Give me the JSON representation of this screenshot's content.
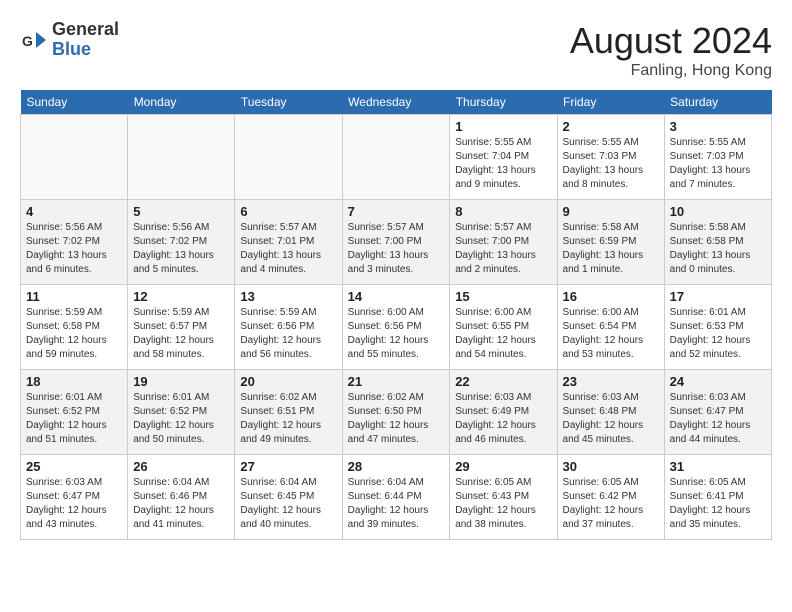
{
  "header": {
    "logo_general": "General",
    "logo_blue": "Blue",
    "month_title": "August 2024",
    "location": "Fanling, Hong Kong"
  },
  "days_of_week": [
    "Sunday",
    "Monday",
    "Tuesday",
    "Wednesday",
    "Thursday",
    "Friday",
    "Saturday"
  ],
  "weeks": [
    [
      {
        "day": "",
        "info": ""
      },
      {
        "day": "",
        "info": ""
      },
      {
        "day": "",
        "info": ""
      },
      {
        "day": "",
        "info": ""
      },
      {
        "day": "1",
        "info": "Sunrise: 5:55 AM\nSunset: 7:04 PM\nDaylight: 13 hours\nand 9 minutes."
      },
      {
        "day": "2",
        "info": "Sunrise: 5:55 AM\nSunset: 7:03 PM\nDaylight: 13 hours\nand 8 minutes."
      },
      {
        "day": "3",
        "info": "Sunrise: 5:55 AM\nSunset: 7:03 PM\nDaylight: 13 hours\nand 7 minutes."
      }
    ],
    [
      {
        "day": "4",
        "info": "Sunrise: 5:56 AM\nSunset: 7:02 PM\nDaylight: 13 hours\nand 6 minutes."
      },
      {
        "day": "5",
        "info": "Sunrise: 5:56 AM\nSunset: 7:02 PM\nDaylight: 13 hours\nand 5 minutes."
      },
      {
        "day": "6",
        "info": "Sunrise: 5:57 AM\nSunset: 7:01 PM\nDaylight: 13 hours\nand 4 minutes."
      },
      {
        "day": "7",
        "info": "Sunrise: 5:57 AM\nSunset: 7:00 PM\nDaylight: 13 hours\nand 3 minutes."
      },
      {
        "day": "8",
        "info": "Sunrise: 5:57 AM\nSunset: 7:00 PM\nDaylight: 13 hours\nand 2 minutes."
      },
      {
        "day": "9",
        "info": "Sunrise: 5:58 AM\nSunset: 6:59 PM\nDaylight: 13 hours\nand 1 minute."
      },
      {
        "day": "10",
        "info": "Sunrise: 5:58 AM\nSunset: 6:58 PM\nDaylight: 13 hours\nand 0 minutes."
      }
    ],
    [
      {
        "day": "11",
        "info": "Sunrise: 5:59 AM\nSunset: 6:58 PM\nDaylight: 12 hours\nand 59 minutes."
      },
      {
        "day": "12",
        "info": "Sunrise: 5:59 AM\nSunset: 6:57 PM\nDaylight: 12 hours\nand 58 minutes."
      },
      {
        "day": "13",
        "info": "Sunrise: 5:59 AM\nSunset: 6:56 PM\nDaylight: 12 hours\nand 56 minutes."
      },
      {
        "day": "14",
        "info": "Sunrise: 6:00 AM\nSunset: 6:56 PM\nDaylight: 12 hours\nand 55 minutes."
      },
      {
        "day": "15",
        "info": "Sunrise: 6:00 AM\nSunset: 6:55 PM\nDaylight: 12 hours\nand 54 minutes."
      },
      {
        "day": "16",
        "info": "Sunrise: 6:00 AM\nSunset: 6:54 PM\nDaylight: 12 hours\nand 53 minutes."
      },
      {
        "day": "17",
        "info": "Sunrise: 6:01 AM\nSunset: 6:53 PM\nDaylight: 12 hours\nand 52 minutes."
      }
    ],
    [
      {
        "day": "18",
        "info": "Sunrise: 6:01 AM\nSunset: 6:52 PM\nDaylight: 12 hours\nand 51 minutes."
      },
      {
        "day": "19",
        "info": "Sunrise: 6:01 AM\nSunset: 6:52 PM\nDaylight: 12 hours\nand 50 minutes."
      },
      {
        "day": "20",
        "info": "Sunrise: 6:02 AM\nSunset: 6:51 PM\nDaylight: 12 hours\nand 49 minutes."
      },
      {
        "day": "21",
        "info": "Sunrise: 6:02 AM\nSunset: 6:50 PM\nDaylight: 12 hours\nand 47 minutes."
      },
      {
        "day": "22",
        "info": "Sunrise: 6:03 AM\nSunset: 6:49 PM\nDaylight: 12 hours\nand 46 minutes."
      },
      {
        "day": "23",
        "info": "Sunrise: 6:03 AM\nSunset: 6:48 PM\nDaylight: 12 hours\nand 45 minutes."
      },
      {
        "day": "24",
        "info": "Sunrise: 6:03 AM\nSunset: 6:47 PM\nDaylight: 12 hours\nand 44 minutes."
      }
    ],
    [
      {
        "day": "25",
        "info": "Sunrise: 6:03 AM\nSunset: 6:47 PM\nDaylight: 12 hours\nand 43 minutes."
      },
      {
        "day": "26",
        "info": "Sunrise: 6:04 AM\nSunset: 6:46 PM\nDaylight: 12 hours\nand 41 minutes."
      },
      {
        "day": "27",
        "info": "Sunrise: 6:04 AM\nSunset: 6:45 PM\nDaylight: 12 hours\nand 40 minutes."
      },
      {
        "day": "28",
        "info": "Sunrise: 6:04 AM\nSunset: 6:44 PM\nDaylight: 12 hours\nand 39 minutes."
      },
      {
        "day": "29",
        "info": "Sunrise: 6:05 AM\nSunset: 6:43 PM\nDaylight: 12 hours\nand 38 minutes."
      },
      {
        "day": "30",
        "info": "Sunrise: 6:05 AM\nSunset: 6:42 PM\nDaylight: 12 hours\nand 37 minutes."
      },
      {
        "day": "31",
        "info": "Sunrise: 6:05 AM\nSunset: 6:41 PM\nDaylight: 12 hours\nand 35 minutes."
      }
    ]
  ]
}
